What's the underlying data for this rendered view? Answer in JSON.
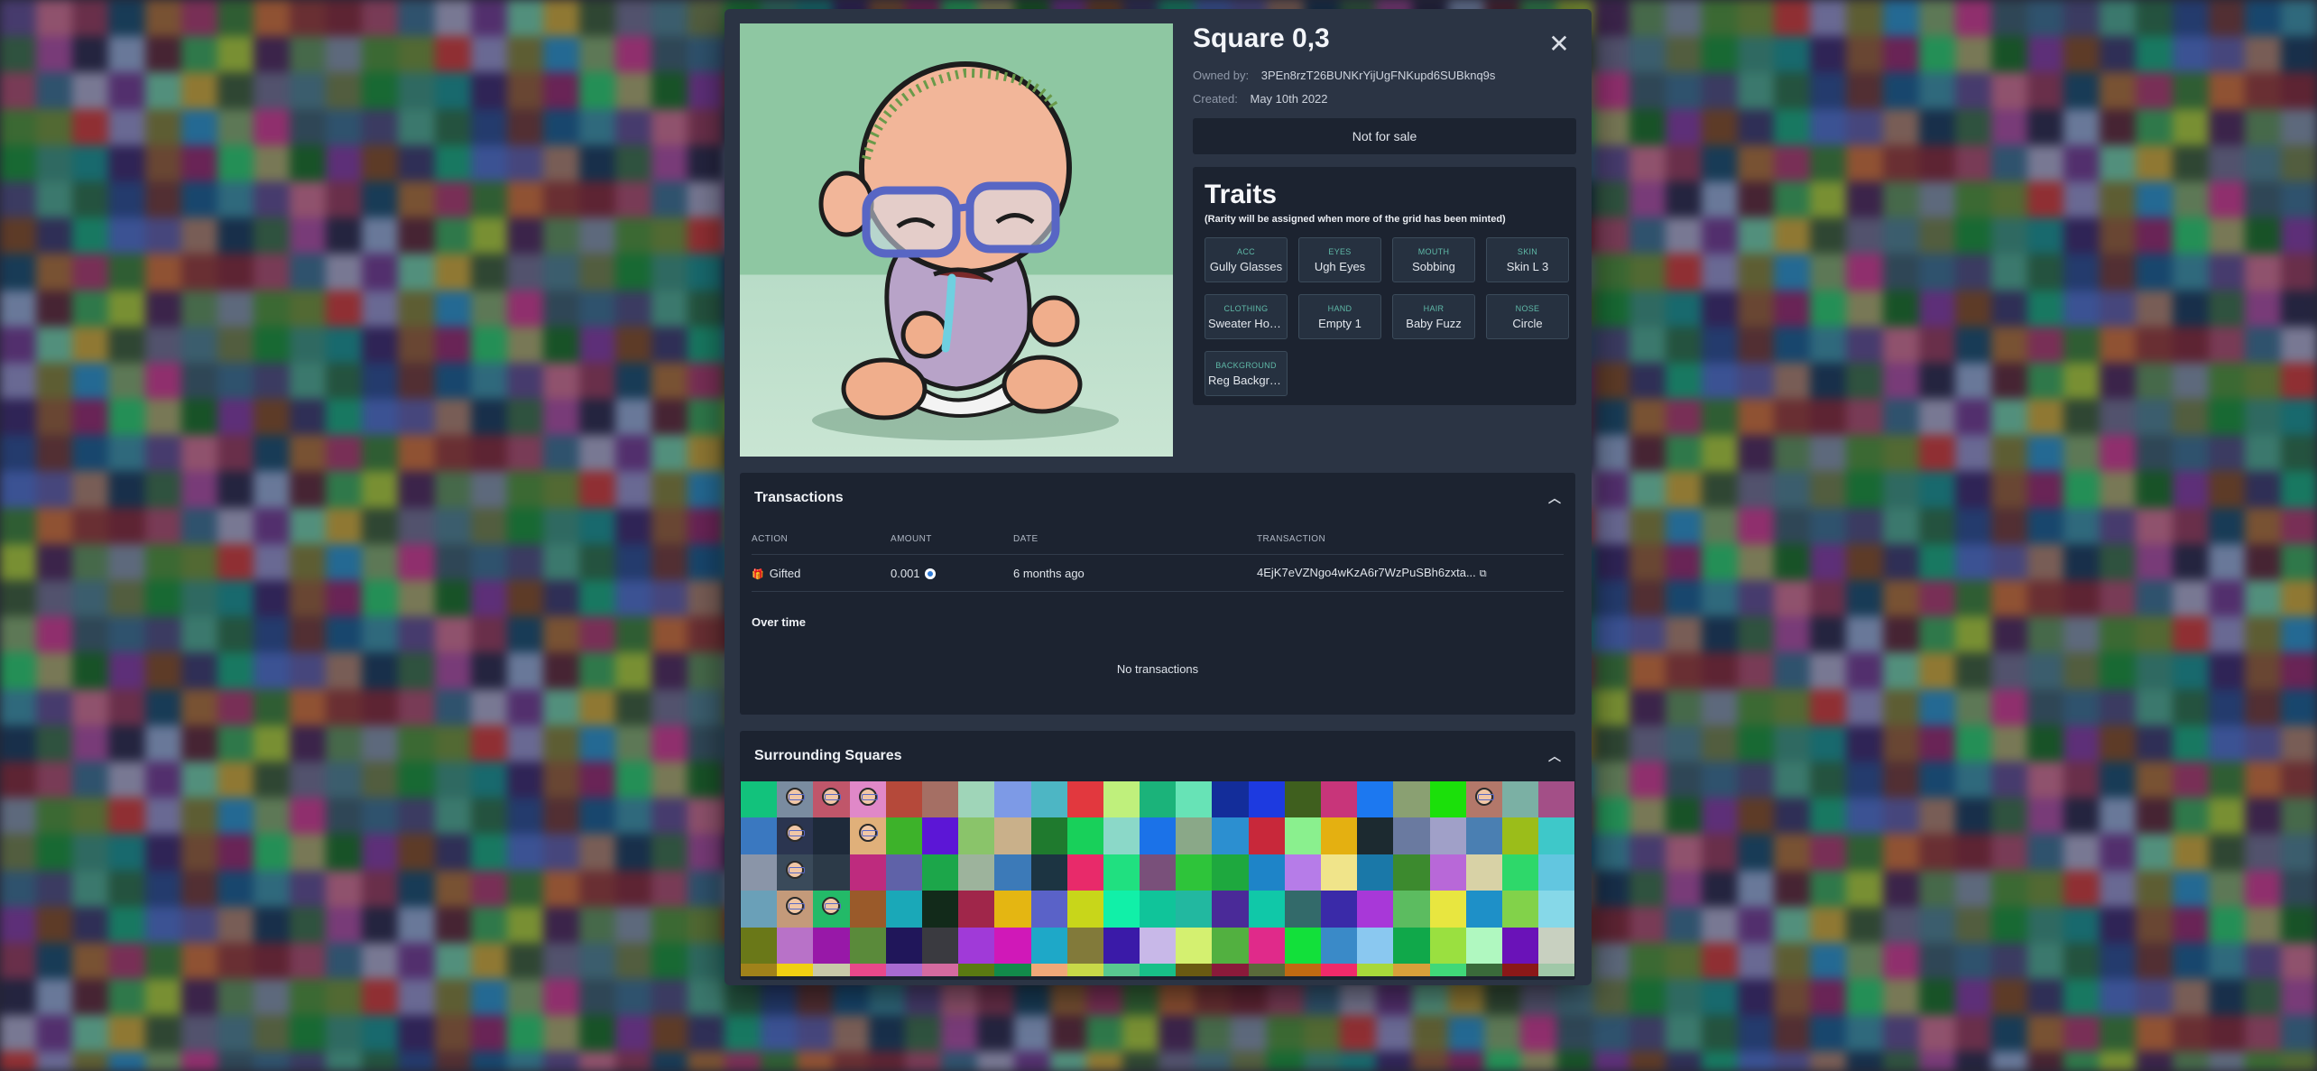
{
  "modal": {
    "title": "Square 0,3",
    "owned_by_label": "Owned by:",
    "owned_by_value": "3PEn8rzT26BUNKrYijUgFNKupd6SUBknq9s",
    "created_label": "Created:",
    "created_value": "May 10th 2022",
    "sale_status": "Not for sale",
    "close_icon": "close-icon"
  },
  "traits": {
    "title": "Traits",
    "note": "(Rarity will be assigned when more of the grid has been minted)",
    "items": [
      {
        "key": "ACC",
        "value": "Gully Glasses"
      },
      {
        "key": "EYES",
        "value": "Ugh Eyes"
      },
      {
        "key": "MOUTH",
        "value": "Sobbing"
      },
      {
        "key": "SKIN",
        "value": "Skin L 3"
      },
      {
        "key": "CLOTHING",
        "value": "Sweater Hoodie"
      },
      {
        "key": "HAND",
        "value": "Empty 1"
      },
      {
        "key": "HAIR",
        "value": "Baby Fuzz"
      },
      {
        "key": "NOSE",
        "value": "Circle"
      },
      {
        "key": "BACKGROUND",
        "value": "Reg Background"
      }
    ]
  },
  "transactions": {
    "title": "Transactions",
    "columns": [
      "ACTION",
      "AMOUNT",
      "DATE",
      "TRANSACTION"
    ],
    "rows": [
      {
        "action": "Gifted",
        "amount": "0.001",
        "date": "6 months ago",
        "transaction": "4EjK7eVZNgo4wKzA6r7WzPuSBh6zxta..."
      }
    ],
    "over_time_label": "Over time",
    "empty_label": "No transactions"
  },
  "surrounding": {
    "title": "Surrounding Squares",
    "colors": [
      "#12c27c",
      "#7a8ca0",
      "#c0566a",
      "#e088c8",
      "#b5493a",
      "#a56f64",
      "#9fd5b8",
      "#7d9ae6",
      "#4db6c4",
      "#e2383e",
      "#bff07c",
      "#1bb37a",
      "#67e3b6",
      "#132d9a",
      "#1d3ae0",
      "#3f5f1e",
      "#c8357a",
      "#1c78f0",
      "#8aa072",
      "#1be00a",
      "#b3786a",
      "#7bb0a4",
      "#a34f87",
      "#3a78c0",
      "#2b3550",
      "#1e2a3a",
      "#e0b07a",
      "#3db22a",
      "#5c16d6",
      "#8ac46a",
      "#c9b08a",
      "#1f7a2e",
      "#18d05a",
      "#8bd8c8",
      "#1b72e8",
      "#8aa888",
      "#2c8fd0",
      "#c8283a",
      "#8af08e",
      "#e4b011",
      "#1c2a30",
      "#6a7aa0",
      "#a0a0c8",
      "#4a7fb2",
      "#9bbd1a",
      "#3ec8c9",
      "#8a95a8",
      "#3a4a5a",
      "#2c3a48",
      "#be2b7e",
      "#5f62a8",
      "#1ca64a",
      "#9db39c",
      "#3c7ab8",
      "#1c3442",
      "#e82a6a",
      "#20e080",
      "#79507a",
      "#2ec43a",
      "#1ea83e",
      "#1e84c8",
      "#b67ce8",
      "#f0e48a",
      "#1a78a8",
      "#3c8a2e",
      "#b868d8",
      "#d8d2a6",
      "#2ed86a",
      "#62c6e0",
      "#6aa0b8",
      "#c49a7a",
      "#23ba68",
      "#9a5a2a",
      "#1aa8b8",
      "#122a1a",
      "#a0264a",
      "#e4b612",
      "#5a62c8",
      "#c8d61a",
      "#11f0a8",
      "#10c49a",
      "#22b8a0",
      "#4a2a98",
      "#10c8a8",
      "#336a6a",
      "#3a2aa8",
      "#a838d8",
      "#5cbc60",
      "#e8e640",
      "#1e90c8",
      "#82d24a",
      "#86d8e8",
      "#6a7818",
      "#b872c8",
      "#9818a8",
      "#5a8a3a",
      "#20165a",
      "#3a3a40",
      "#a03ad8",
      "#d018b8",
      "#1ea8c8",
      "#827a3a",
      "#3a1aa8",
      "#c8b8e8",
      "#d4f070",
      "#52b040",
      "#e02a8a",
      "#12e03a",
      "#3a8ac8",
      "#8ac8f0",
      "#10a84a",
      "#9ae040",
      "#b0f8c0",
      "#6a12b8",
      "#c8d0c0",
      "#a0821a",
      "#f0d012",
      "#c8c8a8",
      "#e8488a",
      "#a86ad0",
      "#d46aa0",
      "#5a7a12",
      "#128a4a",
      "#f0a878",
      "#c8d848",
      "#58c890",
      "#18c088",
      "#6a5a12",
      "#8a1a3a",
      "#5a6a3a",
      "#c06a12",
      "#f02a6a",
      "#a8d83a",
      "#d8a03a",
      "#40d878",
      "#3a6a3a",
      "#8a1818",
      "#a0c8a8"
    ],
    "character_cells": [
      1,
      2,
      3,
      24,
      26,
      47,
      70,
      71,
      20
    ]
  },
  "background_colors": [
    "#5a4a8a",
    "#3a5a6a",
    "#7a8aa0",
    "#3a6a4a",
    "#1a6a2a",
    "#6a7a4a",
    "#a04a6a",
    "#c06a8a",
    "#3a6a8a",
    "#4a8a3a",
    "#a04a9a",
    "#7a3a9a",
    "#1a8a3a",
    "#3a6a8a",
    "#8a3a5a",
    "#4a4a7a",
    "#6a8a3a",
    "#2a2a4a",
    "#7a4a2a",
    "#3a8a7a",
    "#a0a0c0",
    "#1a4a6a",
    "#4aa08a",
    "#c03a3a",
    "#8aa0c8",
    "#3a3a6a",
    "#1a8a8a",
    "#6a3a8a",
    "#a06a3a",
    "#2a6a4a",
    "#8a8ac0",
    "#5a2a3a",
    "#1aa07a",
    "#3a2a6a",
    "#6ac0a0",
    "#a03a6a",
    "#2a4a8a",
    "#7a7a3a",
    "#3aa05a",
    "#4a6ac0",
    "#8a5a3a",
    "#c0a03a",
    "#3a7a3a",
    "#6a3a3a",
    "#2a8ac0",
    "#a0c03a",
    "#5a5aa0",
    "#8a2a6a",
    "#3a5a3a",
    "#c06a3a",
    "#1a5a8a",
    "#7aa06a",
    "#4a2a5a",
    "#a07a6a",
    "#2ac06a",
    "#6a6a8a",
    "#8a3a3a",
    "#3a8aa0",
    "#c03a8a",
    "#5a8a5a",
    "#1a3a5a",
    "#a0a06a",
    "#4a7a8a",
    "#7a2a3a"
  ]
}
